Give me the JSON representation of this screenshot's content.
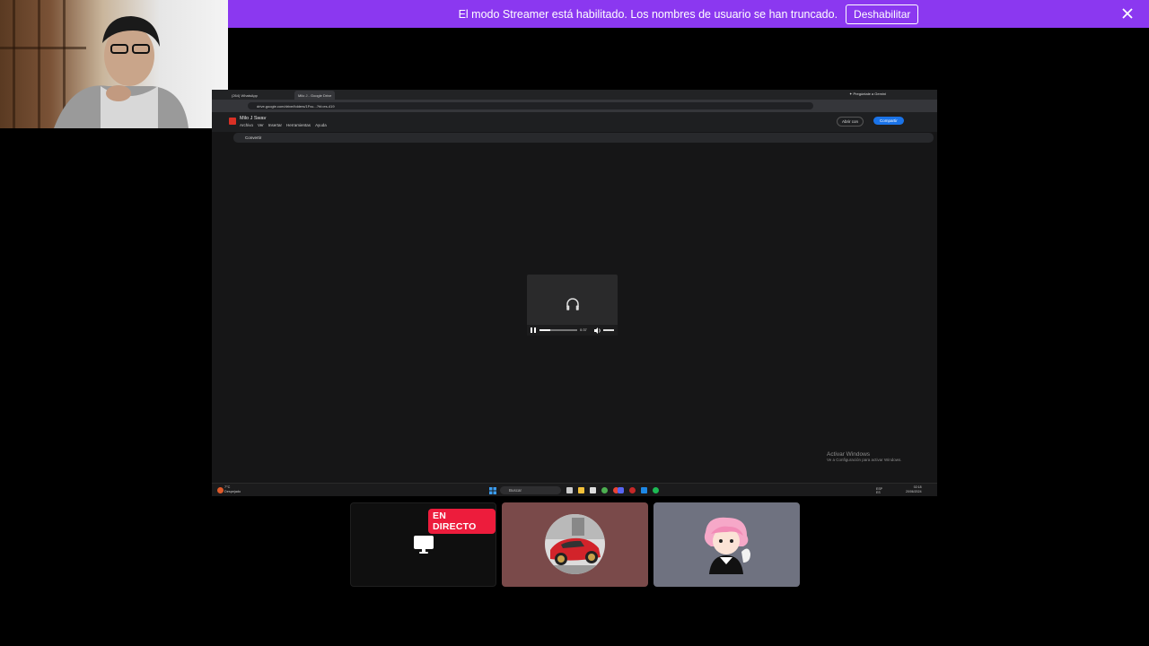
{
  "banner": {
    "message": "El modo Streamer está habilitado. Los nombres de usuario se han truncado.",
    "button_label": "Deshabilitar",
    "color": "#8b38f0"
  },
  "shared_screen": {
    "tabs": [
      {
        "label": "(264) WhatsApp"
      },
      {
        "label": "Milo J - Google Drive"
      }
    ],
    "gemini_label": "Pregúntale a Gemini",
    "url": "drive.google.com/drive/folders/1Fvu...?hl=es-419",
    "document": {
      "title": "Milo J Swav",
      "menu": [
        "Archivo",
        "Ver",
        "Insertar",
        "Herramientas",
        "Ayuda"
      ],
      "open_with_label": "Abrir con",
      "share_label": "Compartir",
      "convert_label": "Convertir"
    },
    "audio_player": {
      "time": "0:37",
      "progress": 0.29
    },
    "activation": {
      "title": "Activar Windows",
      "subtitle": "Ve a Configuración para activar Windows."
    },
    "taskbar": {
      "weather_temp": "7°C",
      "weather_desc": "Despejado",
      "search_placeholder": "Buscar",
      "lang": "ESP",
      "lang_region": "ES",
      "time": "02:18",
      "date": "20/06/2024"
    }
  },
  "participants": [
    {
      "name": "screen-share",
      "badge": "EN DIRECTO"
    },
    {
      "name": "participant-car"
    },
    {
      "name": "participant-anime"
    }
  ]
}
